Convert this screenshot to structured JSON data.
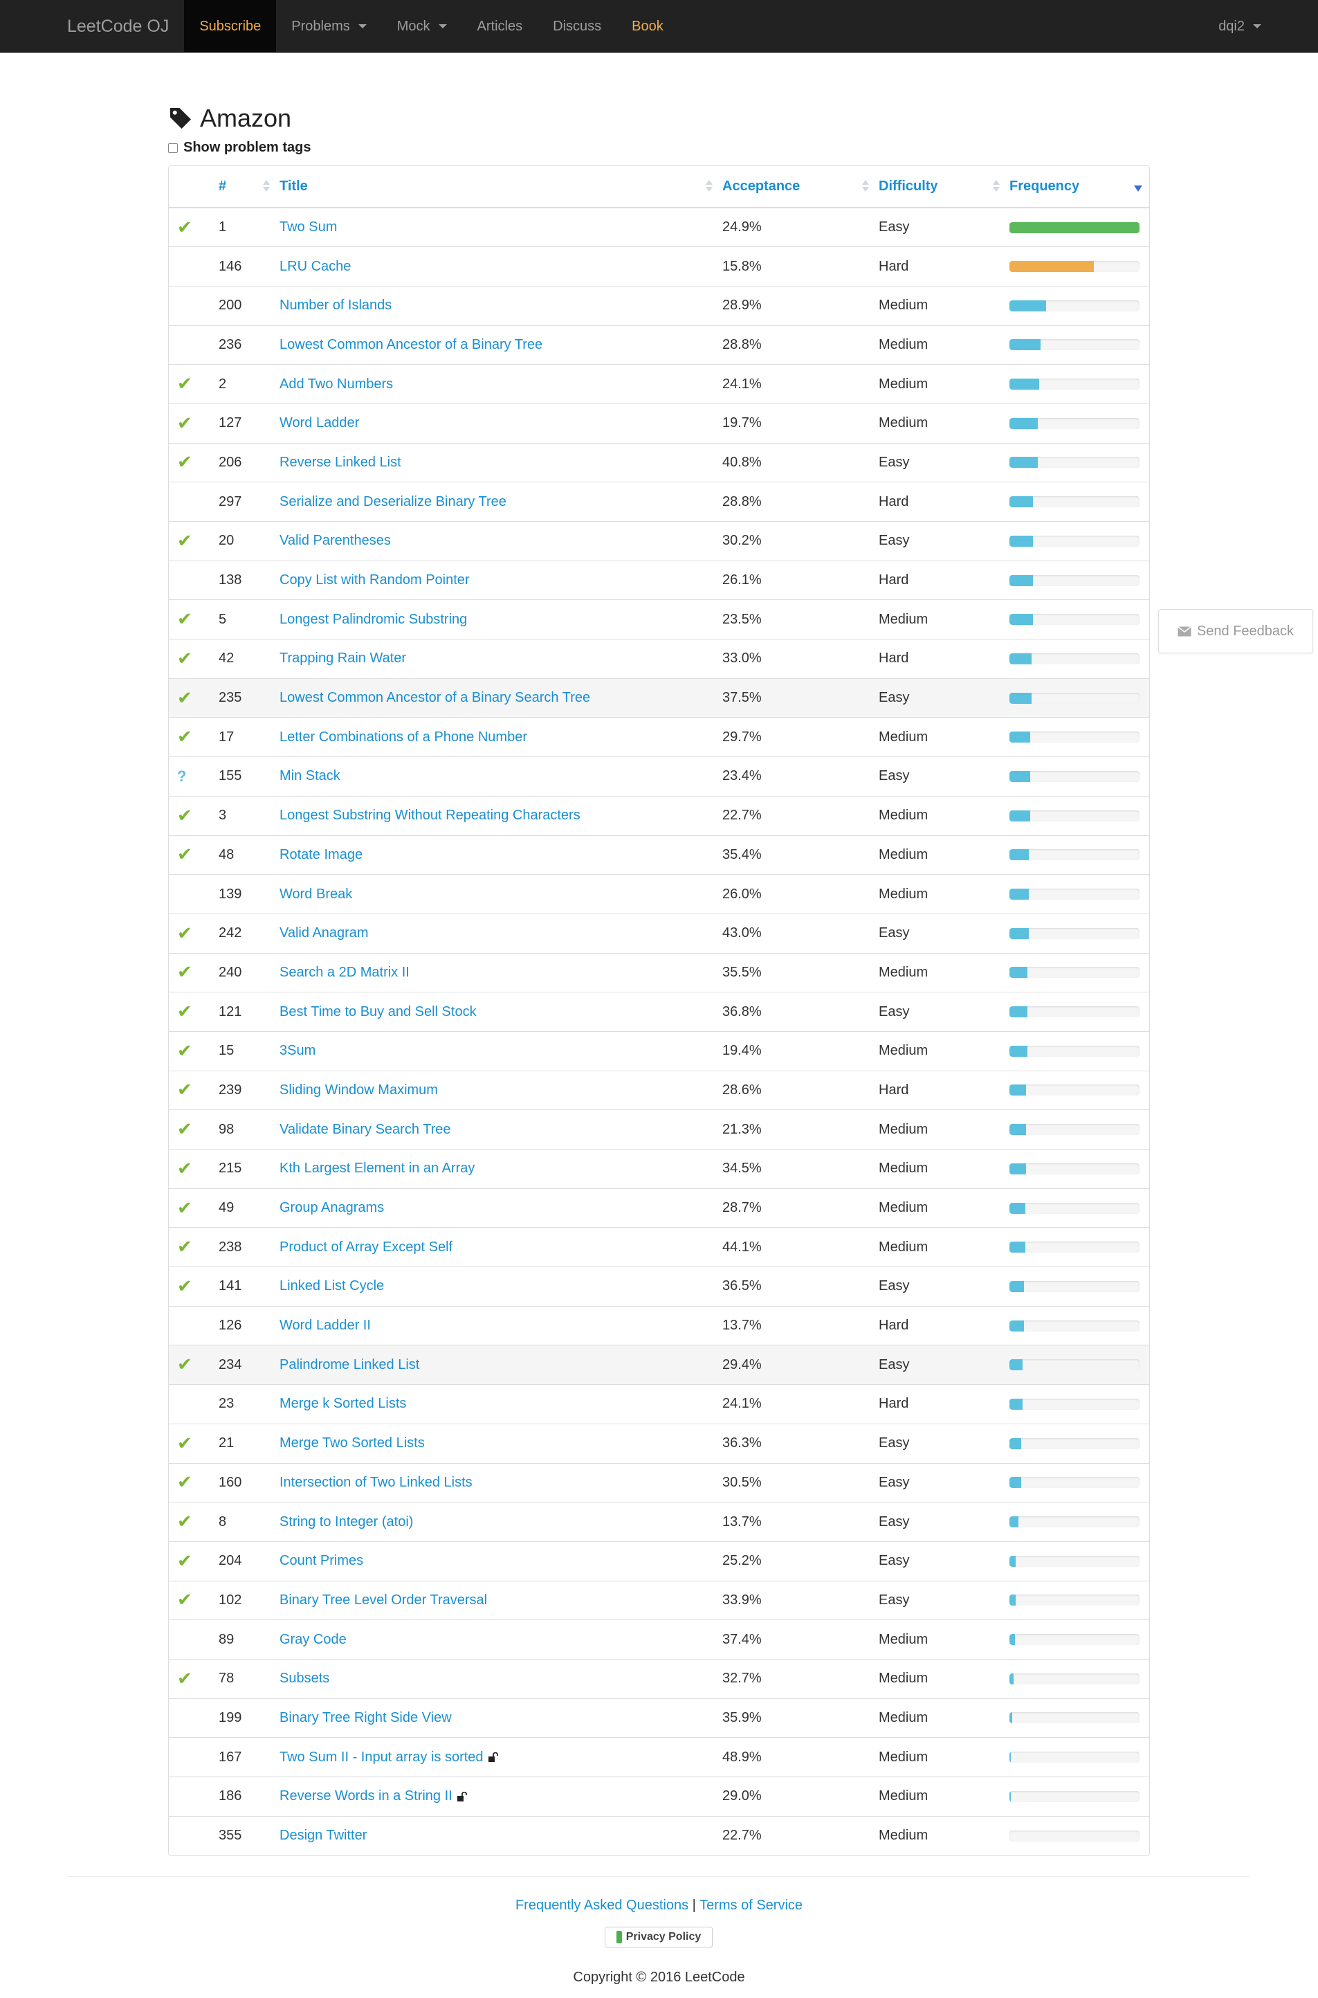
{
  "nav": {
    "brand": "LeetCode OJ",
    "subscribe": "Subscribe",
    "problems": "Problems",
    "mock": "Mock",
    "articles": "Articles",
    "discuss": "Discuss",
    "book": "Book",
    "user": "dqi2"
  },
  "page": {
    "title": "Amazon",
    "show_tags_label": "Show problem tags"
  },
  "table": {
    "headers": {
      "num": "#",
      "title": "Title",
      "acceptance": "Acceptance",
      "difficulty": "Difficulty",
      "frequency": "Frequency"
    },
    "rows": [
      {
        "status": "✔",
        "num": "1",
        "title": "Two Sum",
        "acceptance": "24.9%",
        "difficulty": "Easy",
        "freq": 1.0,
        "color": "#5cb85c"
      },
      {
        "status": "",
        "num": "146",
        "title": "LRU Cache",
        "acceptance": "15.8%",
        "difficulty": "Hard",
        "freq": 0.65,
        "color": "#f0ad4e"
      },
      {
        "status": "",
        "num": "200",
        "title": "Number of Islands",
        "acceptance": "28.9%",
        "difficulty": "Medium",
        "freq": 0.28,
        "color": "#5bc0de"
      },
      {
        "status": "",
        "num": "236",
        "title": "Lowest Common Ancestor of a Binary Tree",
        "acceptance": "28.8%",
        "difficulty": "Medium",
        "freq": 0.24,
        "color": "#5bc0de"
      },
      {
        "status": "✔",
        "num": "2",
        "title": "Add Two Numbers",
        "acceptance": "24.1%",
        "difficulty": "Medium",
        "freq": 0.23,
        "color": "#5bc0de"
      },
      {
        "status": "✔",
        "num": "127",
        "title": "Word Ladder",
        "acceptance": "19.7%",
        "difficulty": "Medium",
        "freq": 0.22,
        "color": "#5bc0de"
      },
      {
        "status": "✔",
        "num": "206",
        "title": "Reverse Linked List",
        "acceptance": "40.8%",
        "difficulty": "Easy",
        "freq": 0.22,
        "color": "#5bc0de"
      },
      {
        "status": "",
        "num": "297",
        "title": "Serialize and Deserialize Binary Tree",
        "acceptance": "28.8%",
        "difficulty": "Hard",
        "freq": 0.18,
        "color": "#5bc0de"
      },
      {
        "status": "✔",
        "num": "20",
        "title": "Valid Parentheses",
        "acceptance": "30.2%",
        "difficulty": "Easy",
        "freq": 0.18,
        "color": "#5bc0de"
      },
      {
        "status": "",
        "num": "138",
        "title": "Copy List with Random Pointer",
        "acceptance": "26.1%",
        "difficulty": "Hard",
        "freq": 0.18,
        "color": "#5bc0de"
      },
      {
        "status": "✔",
        "num": "5",
        "title": "Longest Palindromic Substring",
        "acceptance": "23.5%",
        "difficulty": "Medium",
        "freq": 0.18,
        "color": "#5bc0de"
      },
      {
        "status": "✔",
        "num": "42",
        "title": "Trapping Rain Water",
        "acceptance": "33.0%",
        "difficulty": "Hard",
        "freq": 0.17,
        "color": "#5bc0de"
      },
      {
        "status": "✔",
        "num": "235",
        "title": "Lowest Common Ancestor of a Binary Search Tree",
        "acceptance": "37.5%",
        "difficulty": "Easy",
        "freq": 0.17,
        "color": "#5bc0de",
        "highlight": true
      },
      {
        "status": "✔",
        "num": "17",
        "title": "Letter Combinations of a Phone Number",
        "acceptance": "29.7%",
        "difficulty": "Medium",
        "freq": 0.16,
        "color": "#5bc0de"
      },
      {
        "status": "?",
        "num": "155",
        "title": "Min Stack",
        "acceptance": "23.4%",
        "difficulty": "Easy",
        "freq": 0.16,
        "color": "#5bc0de"
      },
      {
        "status": "✔",
        "num": "3",
        "title": "Longest Substring Without Repeating Characters",
        "acceptance": "22.7%",
        "difficulty": "Medium",
        "freq": 0.16,
        "color": "#5bc0de"
      },
      {
        "status": "✔",
        "num": "48",
        "title": "Rotate Image",
        "acceptance": "35.4%",
        "difficulty": "Medium",
        "freq": 0.15,
        "color": "#5bc0de"
      },
      {
        "status": "",
        "num": "139",
        "title": "Word Break",
        "acceptance": "26.0%",
        "difficulty": "Medium",
        "freq": 0.15,
        "color": "#5bc0de"
      },
      {
        "status": "✔",
        "num": "242",
        "title": "Valid Anagram",
        "acceptance": "43.0%",
        "difficulty": "Easy",
        "freq": 0.15,
        "color": "#5bc0de"
      },
      {
        "status": "✔",
        "num": "240",
        "title": "Search a 2D Matrix II",
        "acceptance": "35.5%",
        "difficulty": "Medium",
        "freq": 0.14,
        "color": "#5bc0de"
      },
      {
        "status": "✔",
        "num": "121",
        "title": "Best Time to Buy and Sell Stock",
        "acceptance": "36.8%",
        "difficulty": "Easy",
        "freq": 0.14,
        "color": "#5bc0de"
      },
      {
        "status": "✔",
        "num": "15",
        "title": "3Sum",
        "acceptance": "19.4%",
        "difficulty": "Medium",
        "freq": 0.14,
        "color": "#5bc0de"
      },
      {
        "status": "✔",
        "num": "239",
        "title": "Sliding Window Maximum",
        "acceptance": "28.6%",
        "difficulty": "Hard",
        "freq": 0.13,
        "color": "#5bc0de"
      },
      {
        "status": "✔",
        "num": "98",
        "title": "Validate Binary Search Tree",
        "acceptance": "21.3%",
        "difficulty": "Medium",
        "freq": 0.13,
        "color": "#5bc0de"
      },
      {
        "status": "✔",
        "num": "215",
        "title": "Kth Largest Element in an Array",
        "acceptance": "34.5%",
        "difficulty": "Medium",
        "freq": 0.13,
        "color": "#5bc0de"
      },
      {
        "status": "✔",
        "num": "49",
        "title": "Group Anagrams",
        "acceptance": "28.7%",
        "difficulty": "Medium",
        "freq": 0.12,
        "color": "#5bc0de"
      },
      {
        "status": "✔",
        "num": "238",
        "title": "Product of Array Except Self",
        "acceptance": "44.1%",
        "difficulty": "Medium",
        "freq": 0.12,
        "color": "#5bc0de"
      },
      {
        "status": "✔",
        "num": "141",
        "title": "Linked List Cycle",
        "acceptance": "36.5%",
        "difficulty": "Easy",
        "freq": 0.11,
        "color": "#5bc0de"
      },
      {
        "status": "",
        "num": "126",
        "title": "Word Ladder II",
        "acceptance": "13.7%",
        "difficulty": "Hard",
        "freq": 0.11,
        "color": "#5bc0de"
      },
      {
        "status": "✔",
        "num": "234",
        "title": "Palindrome Linked List",
        "acceptance": "29.4%",
        "difficulty": "Easy",
        "freq": 0.1,
        "color": "#5bc0de",
        "highlight": true
      },
      {
        "status": "",
        "num": "23",
        "title": "Merge k Sorted Lists",
        "acceptance": "24.1%",
        "difficulty": "Hard",
        "freq": 0.1,
        "color": "#5bc0de"
      },
      {
        "status": "✔",
        "num": "21",
        "title": "Merge Two Sorted Lists",
        "acceptance": "36.3%",
        "difficulty": "Easy",
        "freq": 0.09,
        "color": "#5bc0de"
      },
      {
        "status": "✔",
        "num": "160",
        "title": "Intersection of Two Linked Lists",
        "acceptance": "30.5%",
        "difficulty": "Easy",
        "freq": 0.09,
        "color": "#5bc0de"
      },
      {
        "status": "✔",
        "num": "8",
        "title": "String to Integer (atoi)",
        "acceptance": "13.7%",
        "difficulty": "Easy",
        "freq": 0.07,
        "color": "#5bc0de"
      },
      {
        "status": "✔",
        "num": "204",
        "title": "Count Primes",
        "acceptance": "25.2%",
        "difficulty": "Easy",
        "freq": 0.05,
        "color": "#5bc0de"
      },
      {
        "status": "✔",
        "num": "102",
        "title": "Binary Tree Level Order Traversal",
        "acceptance": "33.9%",
        "difficulty": "Easy",
        "freq": 0.05,
        "color": "#5bc0de"
      },
      {
        "status": "",
        "num": "89",
        "title": "Gray Code",
        "acceptance": "37.4%",
        "difficulty": "Medium",
        "freq": 0.04,
        "color": "#5bc0de"
      },
      {
        "status": "✔",
        "num": "78",
        "title": "Subsets",
        "acceptance": "32.7%",
        "difficulty": "Medium",
        "freq": 0.03,
        "color": "#5bc0de"
      },
      {
        "status": "",
        "num": "199",
        "title": "Binary Tree Right Side View",
        "acceptance": "35.9%",
        "difficulty": "Medium",
        "freq": 0.02,
        "color": "#5bc0de"
      },
      {
        "status": "",
        "num": "167",
        "title": "Two Sum II - Input array is sorted",
        "acceptance": "48.9%",
        "difficulty": "Medium",
        "freq": 0.01,
        "color": "#5bc0de",
        "locked": true
      },
      {
        "status": "",
        "num": "186",
        "title": "Reverse Words in a String II",
        "acceptance": "29.0%",
        "difficulty": "Medium",
        "freq": 0.01,
        "color": "#5bc0de",
        "locked": true
      },
      {
        "status": "",
        "num": "355",
        "title": "Design Twitter",
        "acceptance": "22.7%",
        "difficulty": "Medium",
        "freq": 0.0,
        "color": "#5bc0de"
      }
    ]
  },
  "feedback": {
    "label": "Send Feedback"
  },
  "footer": {
    "faq": "Frequently Asked Questions",
    "separator": "|",
    "terms": "Terms of Service",
    "privacy": "Privacy Policy",
    "copyright": "Copyright © 2016 LeetCode"
  }
}
